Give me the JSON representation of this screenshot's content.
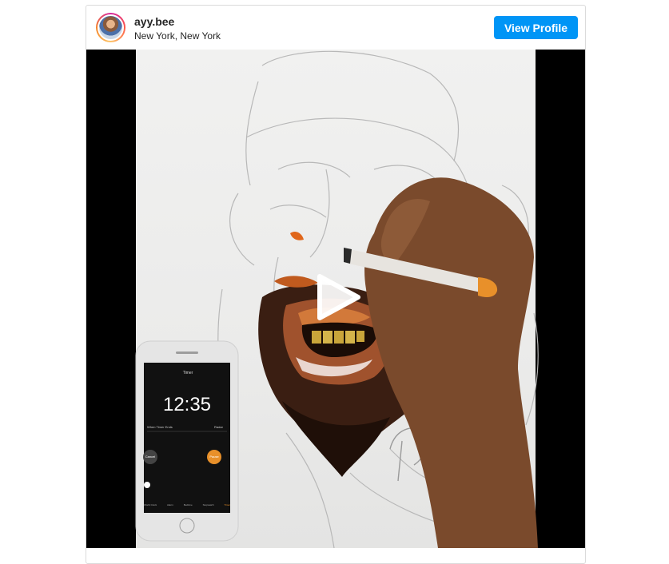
{
  "post": {
    "username": "ayy.bee",
    "location": "New York, New York",
    "view_profile_label": "View Profile"
  },
  "media": {
    "phone_timer_title": "Timer",
    "phone_time": "12:35",
    "phone_row_label": "When Timer Ends",
    "phone_row_value": "Radar",
    "phone_cancel_label": "Cancel",
    "phone_pause_label": "Pause",
    "phone_tabs": [
      "World Clock",
      "Alarm",
      "Bedtime",
      "Stopwatch",
      "Timer"
    ],
    "marker_color": "#e8902a",
    "play_icon": "play-icon"
  }
}
